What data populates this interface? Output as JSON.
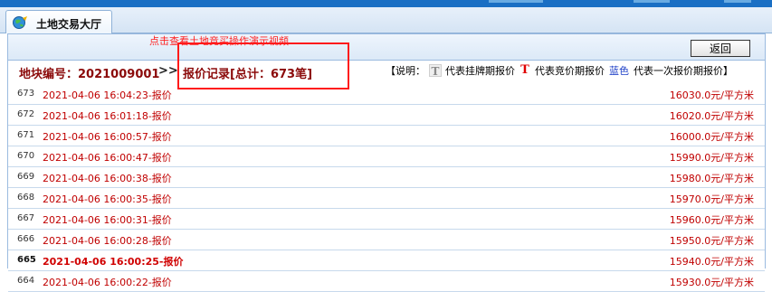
{
  "tab": {
    "label": "土地交易大厅",
    "icon": "globe-icon"
  },
  "toolbar": {
    "video_link": "点击查看土地竞买操作演示视频",
    "back_label": "返回"
  },
  "info": {
    "plot_label": "地块编号：2021009001",
    "arrow": ">>",
    "record_title": "报价记录[总计：673笔]",
    "legend": {
      "prefix": "【说明：",
      "t_gray_glyph": "T",
      "t_gray_text": "代表挂牌期报价",
      "t_red_glyph": "T",
      "t_red_text": "代表竞价期报价",
      "blue_word": "蓝色",
      "blue_text": "代表一次报价期报价】"
    }
  },
  "colors": {
    "accent": "#1a6fc4",
    "record_red": "#c00000",
    "highlight": "#ff1a1a",
    "blue": "#1d3fc7"
  },
  "rows": [
    {
      "num": "673",
      "time": "2021-04-06 16:04:23-报价",
      "price": "16030.0元/平方米"
    },
    {
      "num": "672",
      "time": "2021-04-06 16:01:18-报价",
      "price": "16020.0元/平方米"
    },
    {
      "num": "671",
      "time": "2021-04-06 16:00:57-报价",
      "price": "16000.0元/平方米"
    },
    {
      "num": "670",
      "time": "2021-04-06 16:00:47-报价",
      "price": "15990.0元/平方米"
    },
    {
      "num": "669",
      "time": "2021-04-06 16:00:38-报价",
      "price": "15980.0元/平方米"
    },
    {
      "num": "668",
      "time": "2021-04-06 16:00:35-报价",
      "price": "15970.0元/平方米"
    },
    {
      "num": "667",
      "time": "2021-04-06 16:00:31-报价",
      "price": "15960.0元/平方米"
    },
    {
      "num": "666",
      "time": "2021-04-06 16:00:28-报价",
      "price": "15950.0元/平方米"
    },
    {
      "num": "665",
      "time": "2021-04-06 16:00:25-报价",
      "price": "15940.0元/平方米",
      "bold": true
    },
    {
      "num": "664",
      "time": "2021-04-06 16:00:22-报价",
      "price": "15930.0元/平方米"
    }
  ]
}
